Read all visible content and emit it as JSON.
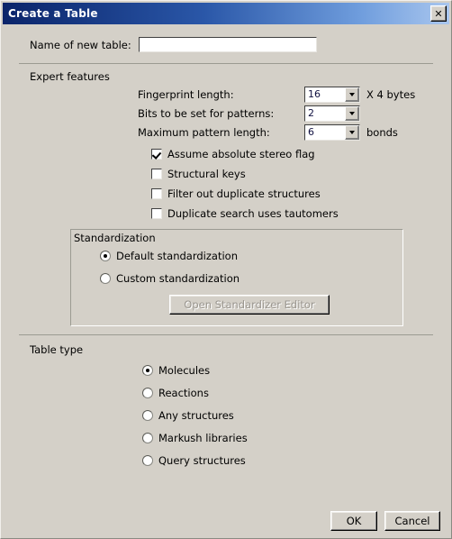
{
  "window": {
    "title": "Create a Table",
    "close_label": "✕",
    "close_icon": "close-icon",
    "title_gradient_from": "#0a246a",
    "title_gradient_to": "#a9c6ee",
    "face_color": "#d4d0c8"
  },
  "name_section": {
    "label": "Name of new table:",
    "value": "",
    "placeholder": ""
  },
  "expert": {
    "title": "Expert features",
    "combos": [
      {
        "label": "Fingerprint length:",
        "value": "16",
        "suffix": "X 4 bytes",
        "arrow_icon": "chevron-down-icon"
      },
      {
        "label": "Bits to be set for patterns:",
        "value": "2",
        "suffix": "",
        "arrow_icon": "chevron-down-icon"
      },
      {
        "label": "Maximum pattern length:",
        "value": "6",
        "suffix": "bonds",
        "arrow_icon": "chevron-down-icon"
      }
    ],
    "checkboxes": [
      {
        "label": "Assume absolute stereo flag",
        "checked": true
      },
      {
        "label": "Structural keys",
        "checked": false
      },
      {
        "label": "Filter out duplicate structures",
        "checked": false
      },
      {
        "label": "Duplicate search uses tautomers",
        "checked": false
      }
    ]
  },
  "standardization": {
    "title": "Standardization",
    "options": [
      {
        "label": "Default standardization",
        "selected": true
      },
      {
        "label": "Custom standardization",
        "selected": false
      }
    ],
    "editor_button": {
      "label": "Open Standardizer Editor",
      "enabled": false
    }
  },
  "table_type": {
    "title": "Table type",
    "options": [
      {
        "label": "Molecules",
        "selected": true
      },
      {
        "label": "Reactions",
        "selected": false
      },
      {
        "label": "Any structures",
        "selected": false
      },
      {
        "label": "Markush libraries",
        "selected": false
      },
      {
        "label": "Query structures",
        "selected": false
      }
    ]
  },
  "footer": {
    "ok_label": "OK",
    "cancel_label": "Cancel"
  }
}
